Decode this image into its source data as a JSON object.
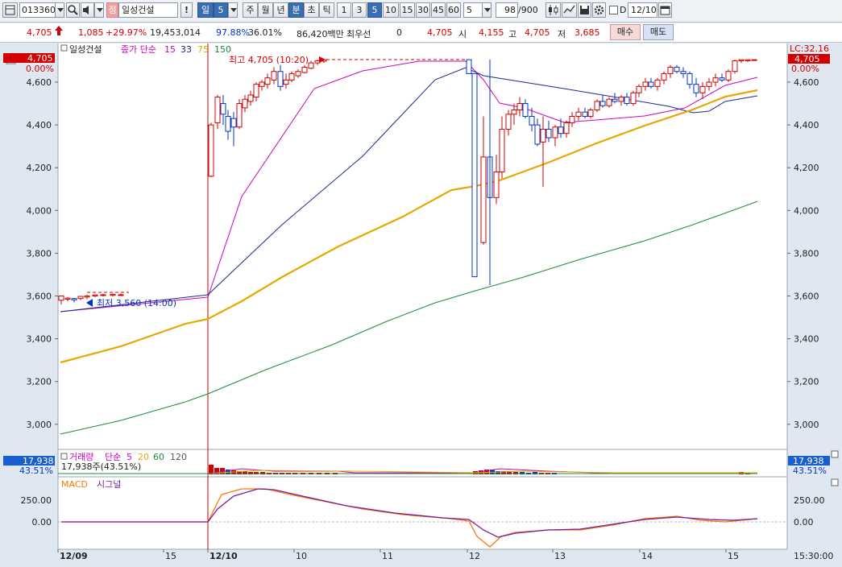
{
  "toolbar": {
    "code": "013360",
    "stock_badge": "점",
    "stock_name": "일성건설",
    "alert": "!",
    "period_day": "일",
    "period_day_value": "5",
    "period_week": "주",
    "period_month": "월",
    "period_year": "년",
    "period_minute": "분",
    "period_second": "초",
    "period_tick": "틱",
    "intervals": [
      "1",
      "3",
      "5",
      "10",
      "15",
      "30",
      "45",
      "60"
    ],
    "active_interval": "5",
    "count_select": "5",
    "count_display": "98",
    "count_total": "/900",
    "checkbox_d_label": "D",
    "date_value": "12/10"
  },
  "info": {
    "price": "4,705",
    "change": "1,085",
    "change_pct": "+29.97%",
    "volume": "19,453,014",
    "ratio1": "97.88%",
    "ratio2": "36.01%",
    "amount": "86,420백만",
    "quote_label": "최우선",
    "quote_value": "0",
    "price2": "4,705",
    "open_label": "시",
    "open_value": "4,155",
    "high_label": "고",
    "high_value": "4,705",
    "low_label": "저",
    "low_value": "3,685",
    "buy_label": "매수",
    "sell_label": "매도"
  },
  "price_panel": {
    "legend_name": "일성건설",
    "legend_series": "종가 단순",
    "ma_periods": [
      "15",
      "33",
      "75",
      "150"
    ],
    "ma_colors": [
      "#d000c0",
      "#1a2a8a",
      "#e6a800",
      "#1a8a3a"
    ],
    "left_price_tag": "4,705",
    "left_pct": "0.00%",
    "right_lc": "LC:32.16",
    "right_price_tag": "4,705",
    "right_pct": "0.00%",
    "high_annotation": "최고 4,705 (10:20)",
    "low_annotation": "최저 3,560 (14:00)",
    "y_ticks": [
      "4,600",
      "4,400",
      "4,200",
      "4,000",
      "3,800",
      "3,600",
      "3,400",
      "3,200",
      "3,000"
    ]
  },
  "volume_panel": {
    "legend_name": "거래량",
    "legend_series": "단순",
    "ma_periods": [
      "5",
      "20",
      "60",
      "120"
    ],
    "ma_colors": [
      "#d000c0",
      "#e6a800",
      "#1a8a3a",
      "#555555"
    ],
    "current": "17,938주(43.51%)",
    "left_tag": "17,938",
    "left_pct": "43.51%",
    "right_tag": "17,938",
    "right_pct": "43.51%"
  },
  "macd_panel": {
    "legend_macd": "MACD",
    "legend_signal": "시그널",
    "macd_color": "#ff7700",
    "signal_color": "#7a1aa0",
    "y_ticks": [
      "250.00",
      "0.00"
    ]
  },
  "time_axis": {
    "labels": [
      "12/09",
      "15",
      "12/10",
      "10",
      "11",
      "12",
      "13",
      "14",
      "15"
    ],
    "clock": "15:30:00"
  },
  "colors": {
    "up": "#d20000",
    "down": "#0033cc",
    "accent": "#3b6db3"
  }
}
